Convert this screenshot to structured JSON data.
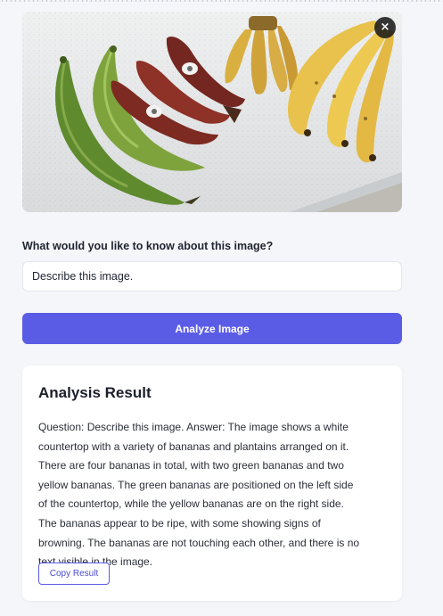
{
  "image": {
    "close_label": "×"
  },
  "prompt": {
    "label": "What would you like to know about this image?",
    "value": "Describe this image."
  },
  "analyze": {
    "button_label": "Analyze Image",
    "accent_color": "#5b5ce6"
  },
  "result": {
    "title": "Analysis Result",
    "text": "Question: Describe this image. Answer: The image shows a white countertop with a variety of bananas and plantains arranged on it. There are four bananas in total, with two green bananas and two yellow bananas. The green bananas are positioned on the left side of the countertop, while the yellow bananas are on the right side. The bananas appear to be ripe, with some showing signs of browning. The bananas are not touching each other, and there is no text visible in the image.",
    "copy_label": "Copy Result"
  },
  "icons": {
    "close": "close-icon"
  }
}
